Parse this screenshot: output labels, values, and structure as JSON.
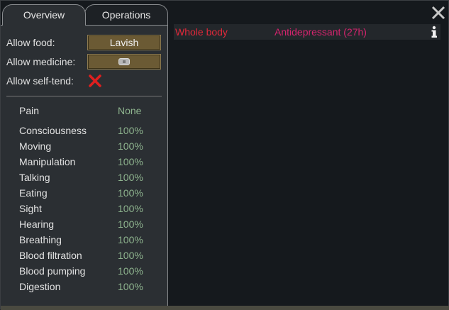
{
  "tabs": [
    {
      "label": "Overview",
      "active": true
    },
    {
      "label": "Operations",
      "active": false
    }
  ],
  "settings": {
    "food": {
      "label": "Allow food:",
      "value": "Lavish"
    },
    "medicine": {
      "label": "Allow medicine:",
      "icon": "medicine-icon"
    },
    "self_tend": {
      "label": "Allow self-tend:",
      "icon": "red-x-icon"
    }
  },
  "pain": {
    "label": "Pain",
    "value": "None"
  },
  "capacities": [
    {
      "label": "Consciousness",
      "value": "100%"
    },
    {
      "label": "Moving",
      "value": "100%"
    },
    {
      "label": "Manipulation",
      "value": "100%"
    },
    {
      "label": "Talking",
      "value": "100%"
    },
    {
      "label": "Eating",
      "value": "100%"
    },
    {
      "label": "Sight",
      "value": "100%"
    },
    {
      "label": "Hearing",
      "value": "100%"
    },
    {
      "label": "Breathing",
      "value": "100%"
    },
    {
      "label": "Blood filtration",
      "value": "100%"
    },
    {
      "label": "Blood pumping",
      "value": "100%"
    },
    {
      "label": "Digestion",
      "value": "100%"
    }
  ],
  "hediffs": [
    {
      "part": "Whole body",
      "name": "Antidepressant (27h)",
      "icon": "info-icon"
    }
  ],
  "colors": {
    "capacity_value": "#8fb58f",
    "hediff_part": "#e0283a",
    "hediff_name": "#d6246e",
    "button": "#6b5a34"
  }
}
